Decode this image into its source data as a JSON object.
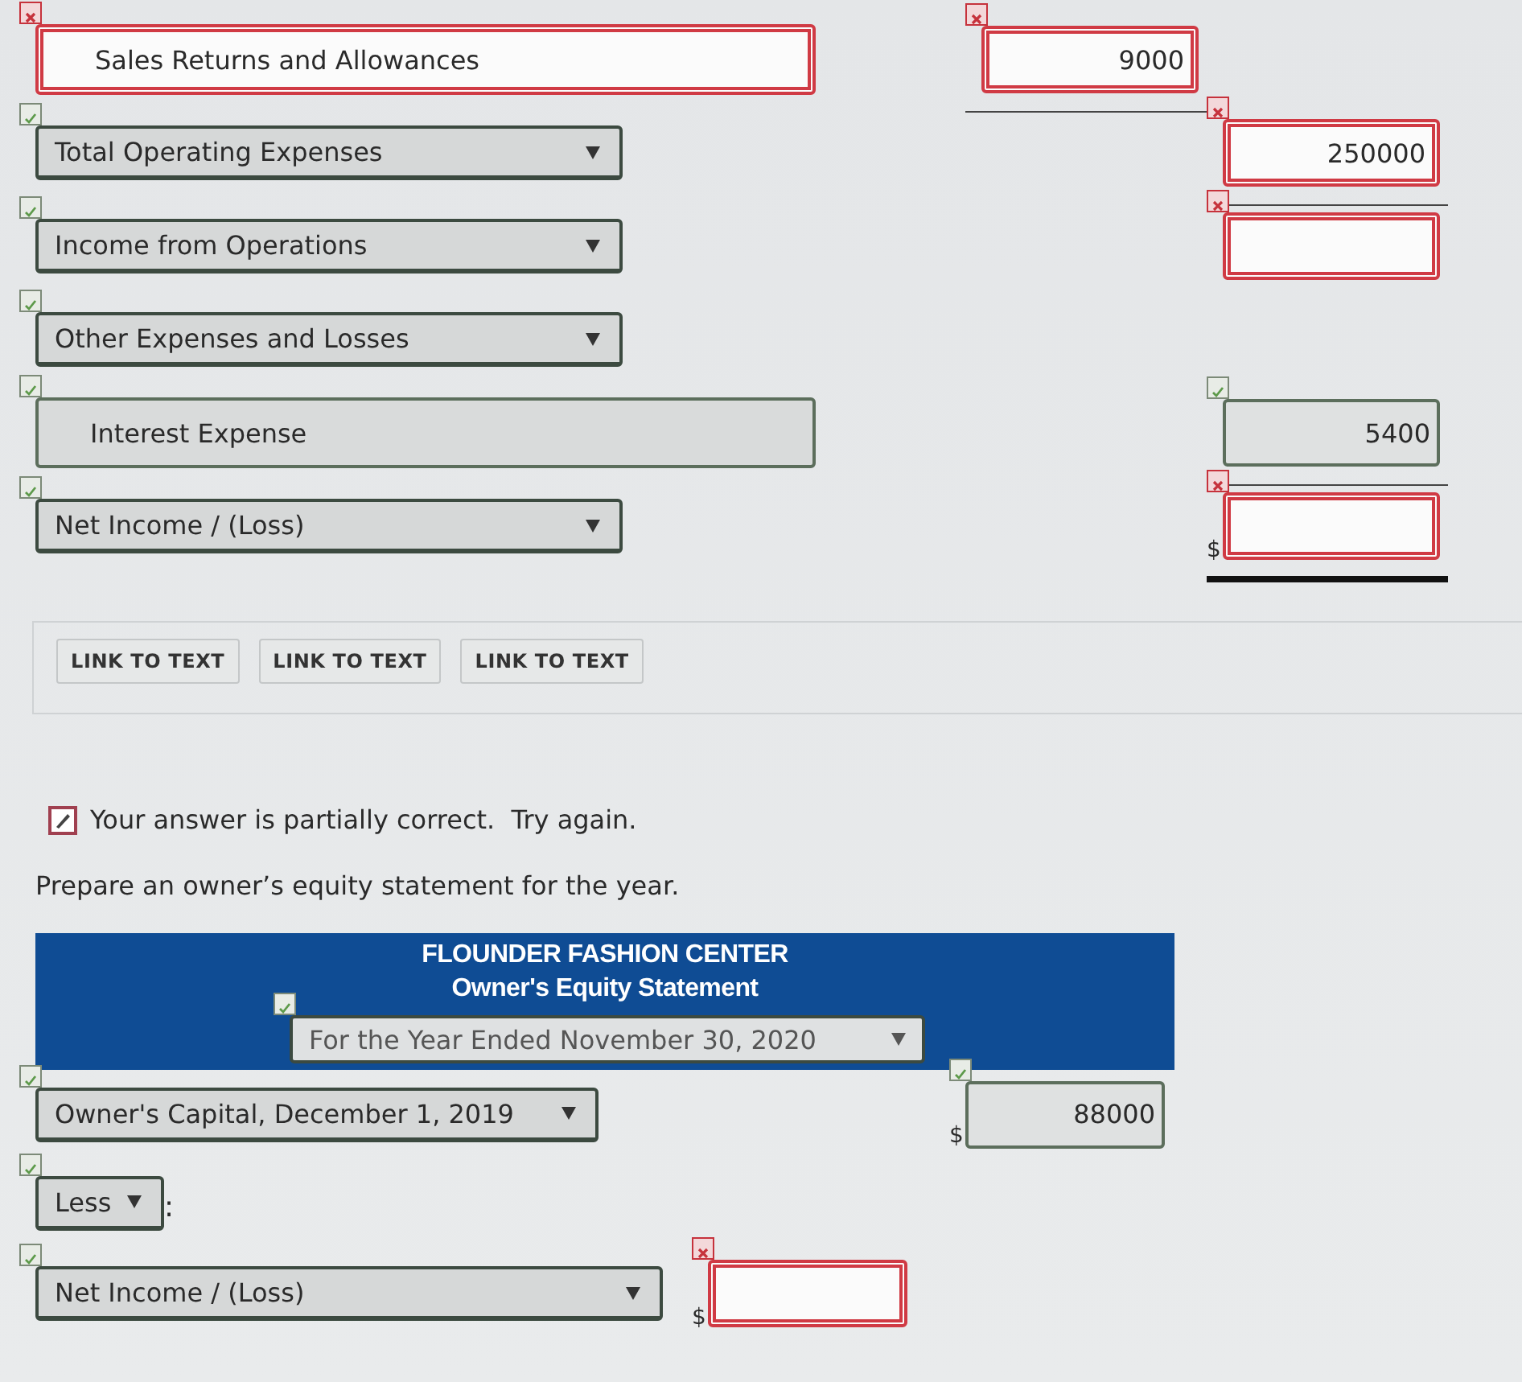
{
  "income_rows": [
    {
      "kind": "text",
      "label": "Sales Returns and Allowances",
      "correct": false,
      "amount": {
        "outer": false,
        "value": "9000",
        "correct": false,
        "underline": true
      }
    },
    {
      "kind": "select",
      "label": "Total Operating Expenses",
      "correct": true,
      "amount": {
        "outer": true,
        "value": "250000",
        "correct": false,
        "underline": true
      }
    },
    {
      "kind": "select",
      "label": "Income from Operations",
      "correct": true,
      "amount": {
        "outer": true,
        "correct": false
      }
    },
    {
      "kind": "select",
      "label": "Other Expenses and Losses",
      "correct": true
    },
    {
      "kind": "text",
      "label": "Interest Expense",
      "correct": true,
      "amount": {
        "outer": true,
        "value": "5400",
        "correct": true,
        "underline": true
      }
    },
    {
      "kind": "select",
      "label": "Net Income / (Loss)",
      "correct": true,
      "amount": {
        "outer": true,
        "currency": "$",
        "correct": false,
        "double_underline": true
      }
    }
  ],
  "links": [
    "LINK TO TEXT",
    "LINK TO TEXT",
    "LINK TO TEXT"
  ],
  "feedback": "Your answer is partially correct.  Try again.",
  "instruction": "Prepare an owner’s equity statement for the year.",
  "statement_header": {
    "company": "FLOUNDER FASHION CENTER",
    "title": "Owner's Equity Statement",
    "period": {
      "label": "For the Year Ended November 30, 2020",
      "correct": true
    }
  },
  "equity_rows": [
    {
      "kind": "select",
      "label": "Owner's Capital, December 1, 2019",
      "correct": true,
      "amount": {
        "outer": true,
        "currency": "$",
        "value": "88000",
        "correct": true
      }
    },
    {
      "kind": "select",
      "label": "Less",
      "correct": true,
      "suffix": ":"
    },
    {
      "kind": "select",
      "label": "Net Income / (Loss)",
      "correct": true,
      "amount": {
        "outer": false,
        "currency": "$",
        "correct": false
      }
    }
  ]
}
